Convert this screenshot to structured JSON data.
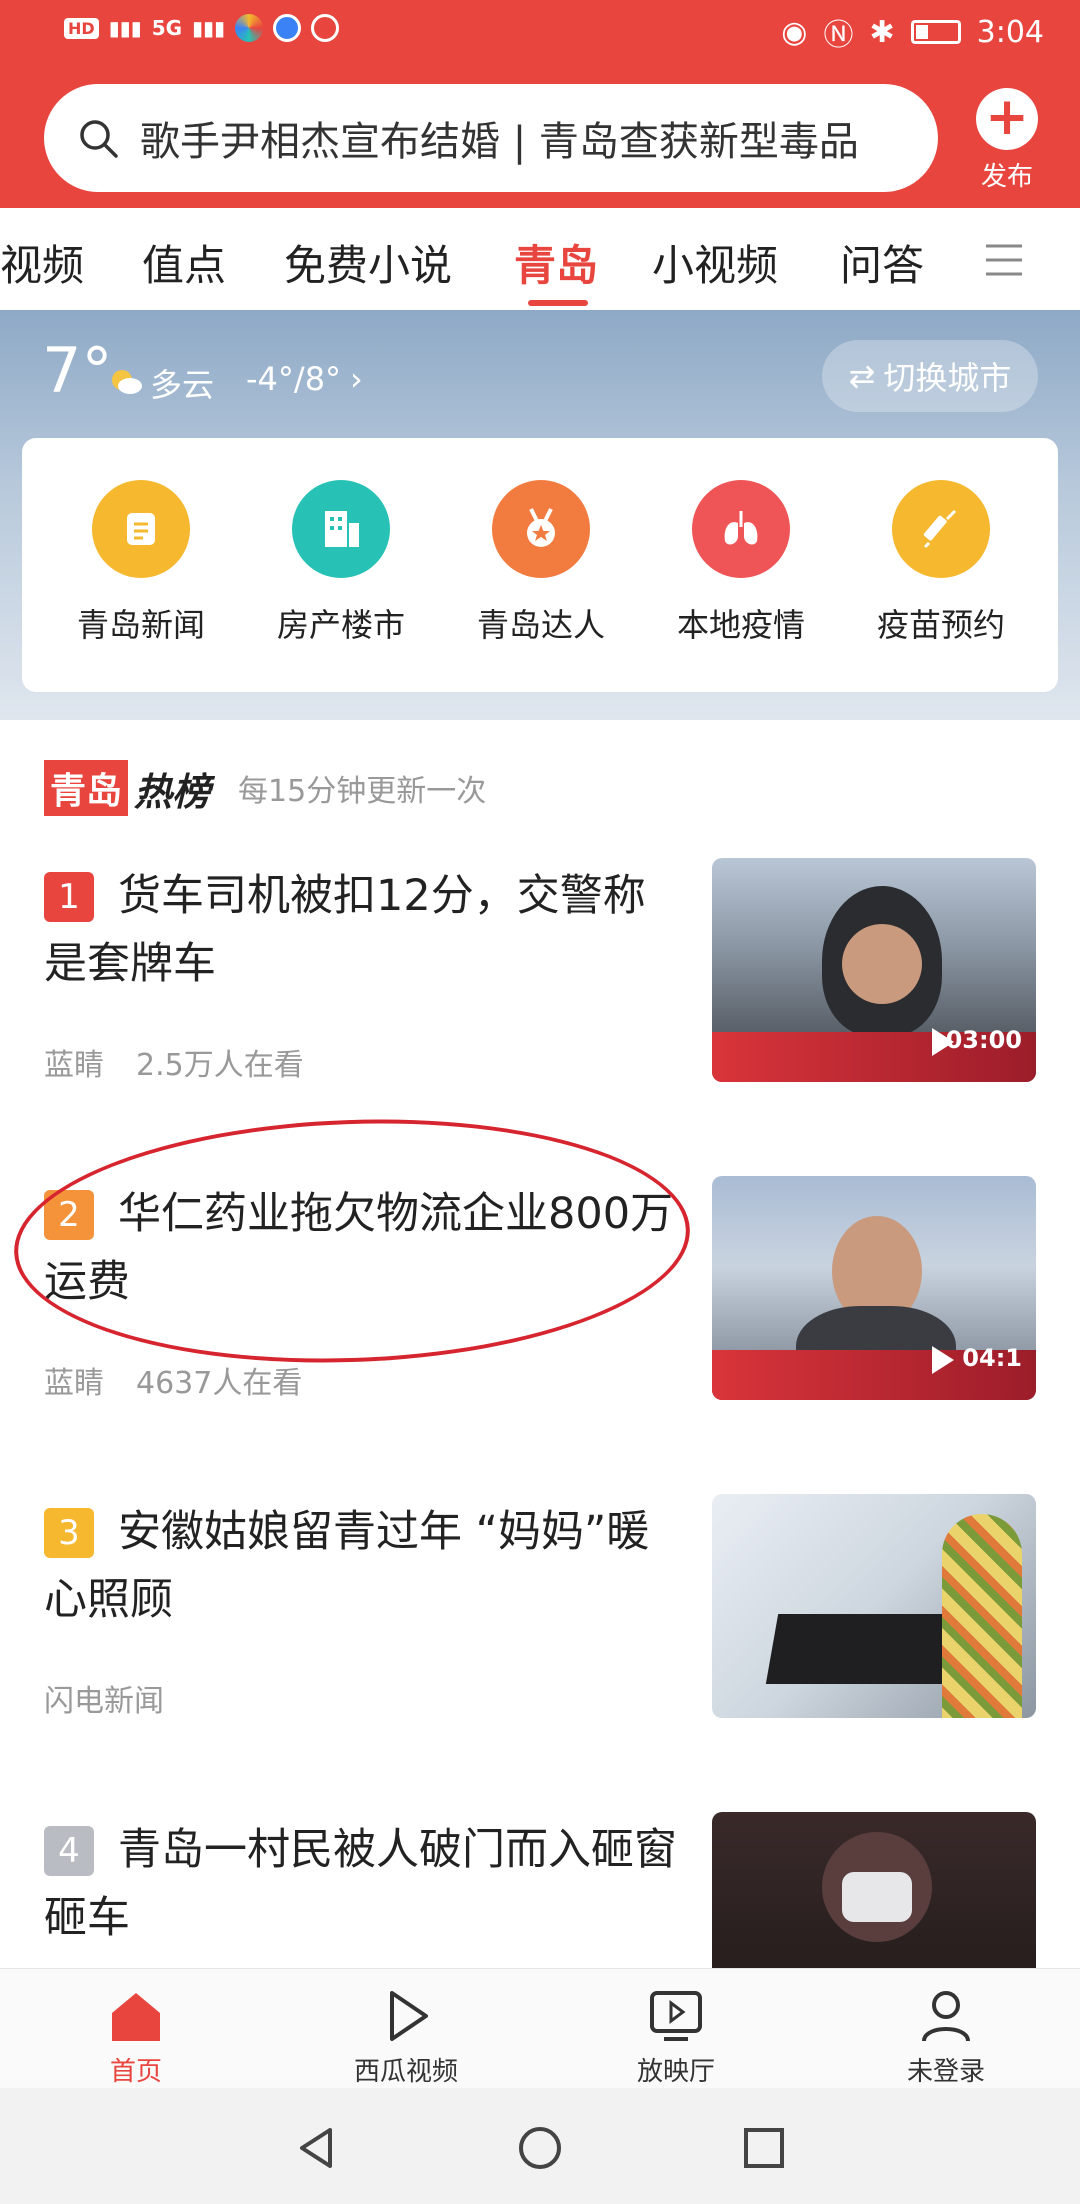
{
  "status_bar": {
    "left_icons": [
      "HD",
      "5G"
    ],
    "right_icons": [
      "eye-icon",
      "nfc-icon",
      "bluetooth-icon"
    ],
    "time": "3:04"
  },
  "search": {
    "text": "歌手尹相杰宣布结婚 | 青岛查获新型毒品"
  },
  "publish": {
    "label": "发布"
  },
  "tabs": [
    "视频",
    "值点",
    "免费小说",
    "青岛",
    "小视频",
    "问答"
  ],
  "active_tab": "青岛",
  "weather": {
    "temp": "7°",
    "condition": "多云",
    "range": "-4°/8°",
    "switch_city": "切换城市"
  },
  "shortcuts": [
    {
      "label": "青岛新闻",
      "color": "#f5b82e"
    },
    {
      "label": "房产楼市",
      "color": "#27c2b5"
    },
    {
      "label": "青岛达人",
      "color": "#f27b3f"
    },
    {
      "label": "本地疫情",
      "color": "#ef5556"
    },
    {
      "label": "疫苗预约",
      "color": "#f5b82e"
    }
  ],
  "hot": {
    "badge": "青岛",
    "title": "热榜",
    "subtitle": "每15分钟更新一次"
  },
  "items": [
    {
      "rank": "1",
      "title": "货车司机被扣12分，交警称是套牌车",
      "source": "蓝睛",
      "views": "2.5万人在看",
      "duration": "03:00",
      "rank_color": "#e8453f"
    },
    {
      "rank": "2",
      "title": "华仁药业拖欠物流企业800万运费",
      "source": "蓝睛",
      "views": "4637人在看",
      "duration": "04:1",
      "rank_color": "#f5933b"
    },
    {
      "rank": "3",
      "title": "安徽姑娘留青过年 “妈妈”暖心照顾",
      "source": "闪电新闻",
      "views": "",
      "duration": "",
      "rank_color": "#f5b82e"
    },
    {
      "rank": "4",
      "title": "青岛一村民被人破门而入砸窗砸车",
      "source": "",
      "views": "",
      "duration": "",
      "rank_color": "#b9bcc3"
    }
  ],
  "bottom_nav": [
    "首页",
    "西瓜视频",
    "放映厅",
    "未登录"
  ],
  "colors": {
    "accent": "#e8453f"
  }
}
